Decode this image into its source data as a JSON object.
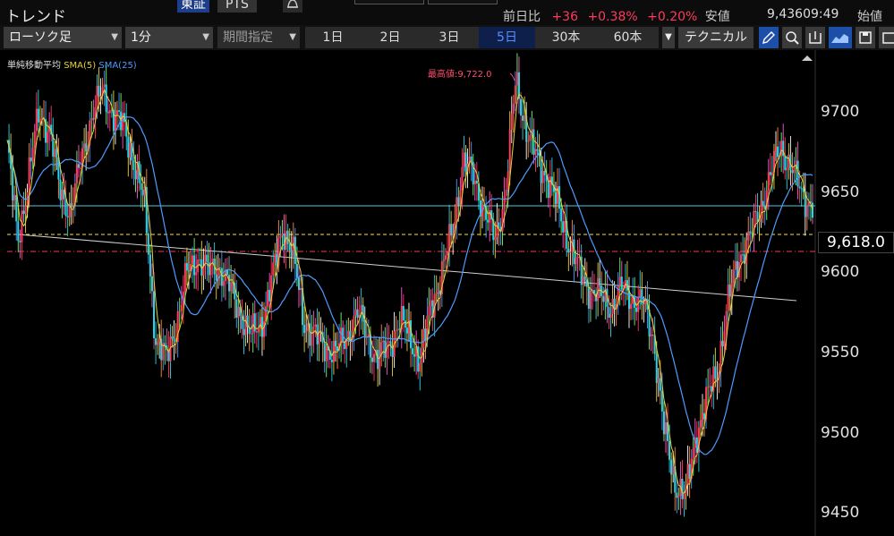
{
  "header": {
    "title": "トレンド",
    "exchange_tabs": [
      "東証",
      "PTS"
    ],
    "quote": {
      "prev_day_label": "前日比",
      "change": "+36",
      "change_pct": "+0.38%",
      "change_pct2": "+0.20%",
      "low_label": "安値",
      "low_value": "9,436",
      "time": "09:49",
      "open_label": "始値"
    }
  },
  "toolbar": {
    "chart_type": "ローソク足",
    "interval": "1分",
    "period": "期間指定",
    "range_tabs": [
      "1日",
      "2日",
      "3日",
      "5日",
      "30本",
      "60本"
    ],
    "active_range": "5日",
    "technical": "テクニカル",
    "icons": [
      "pencil-icon",
      "zoom-icon",
      "output-icon",
      "area-chart-icon",
      "save-icon",
      "window-icon"
    ]
  },
  "indicator": {
    "name": "単純移動平均",
    "sma5": "SMA(5)",
    "sma25": "SMA(25)"
  },
  "chart_data": {
    "type": "line",
    "y_ticks": [
      "9700",
      "9650",
      "9600",
      "9550",
      "9500",
      "9450"
    ],
    "ylim": [
      9440,
      9750
    ],
    "current_price_label": "9,618.0",
    "current_price": 9618.0,
    "high_annotation": "最高値:9,722.0",
    "high_value": 9722.0,
    "colors": {
      "sma5": "#e6d23a",
      "sma25": "#4e9bff",
      "up": "#ff3b5c",
      "down": "#2ad4e6",
      "price_line": "#ffe033",
      "open_line": "#ff3355",
      "ref_line": "#4fc9d6",
      "trendline": "#d0d0d0"
    },
    "price_path": [
      9680,
      9620,
      9660,
      9700,
      9690,
      9650,
      9640,
      9670,
      9700,
      9712,
      9700,
      9690,
      9670,
      9640,
      9560,
      9545,
      9570,
      9600,
      9610,
      9600,
      9605,
      9590,
      9575,
      9560,
      9570,
      9595,
      9630,
      9610,
      9570,
      9560,
      9555,
      9550,
      9560,
      9575,
      9560,
      9545,
      9555,
      9570,
      9560,
      9545,
      9580,
      9600,
      9625,
      9670,
      9660,
      9640,
      9620,
      9650,
      9720,
      9690,
      9670,
      9660,
      9640,
      9620,
      9600,
      9590,
      9585,
      9580,
      9590,
      9585,
      9580,
      9560,
      9500,
      9470,
      9460,
      9500,
      9520,
      9540,
      9580,
      9610,
      9620,
      9640,
      9660,
      9680,
      9665,
      9650,
      9642
    ]
  }
}
